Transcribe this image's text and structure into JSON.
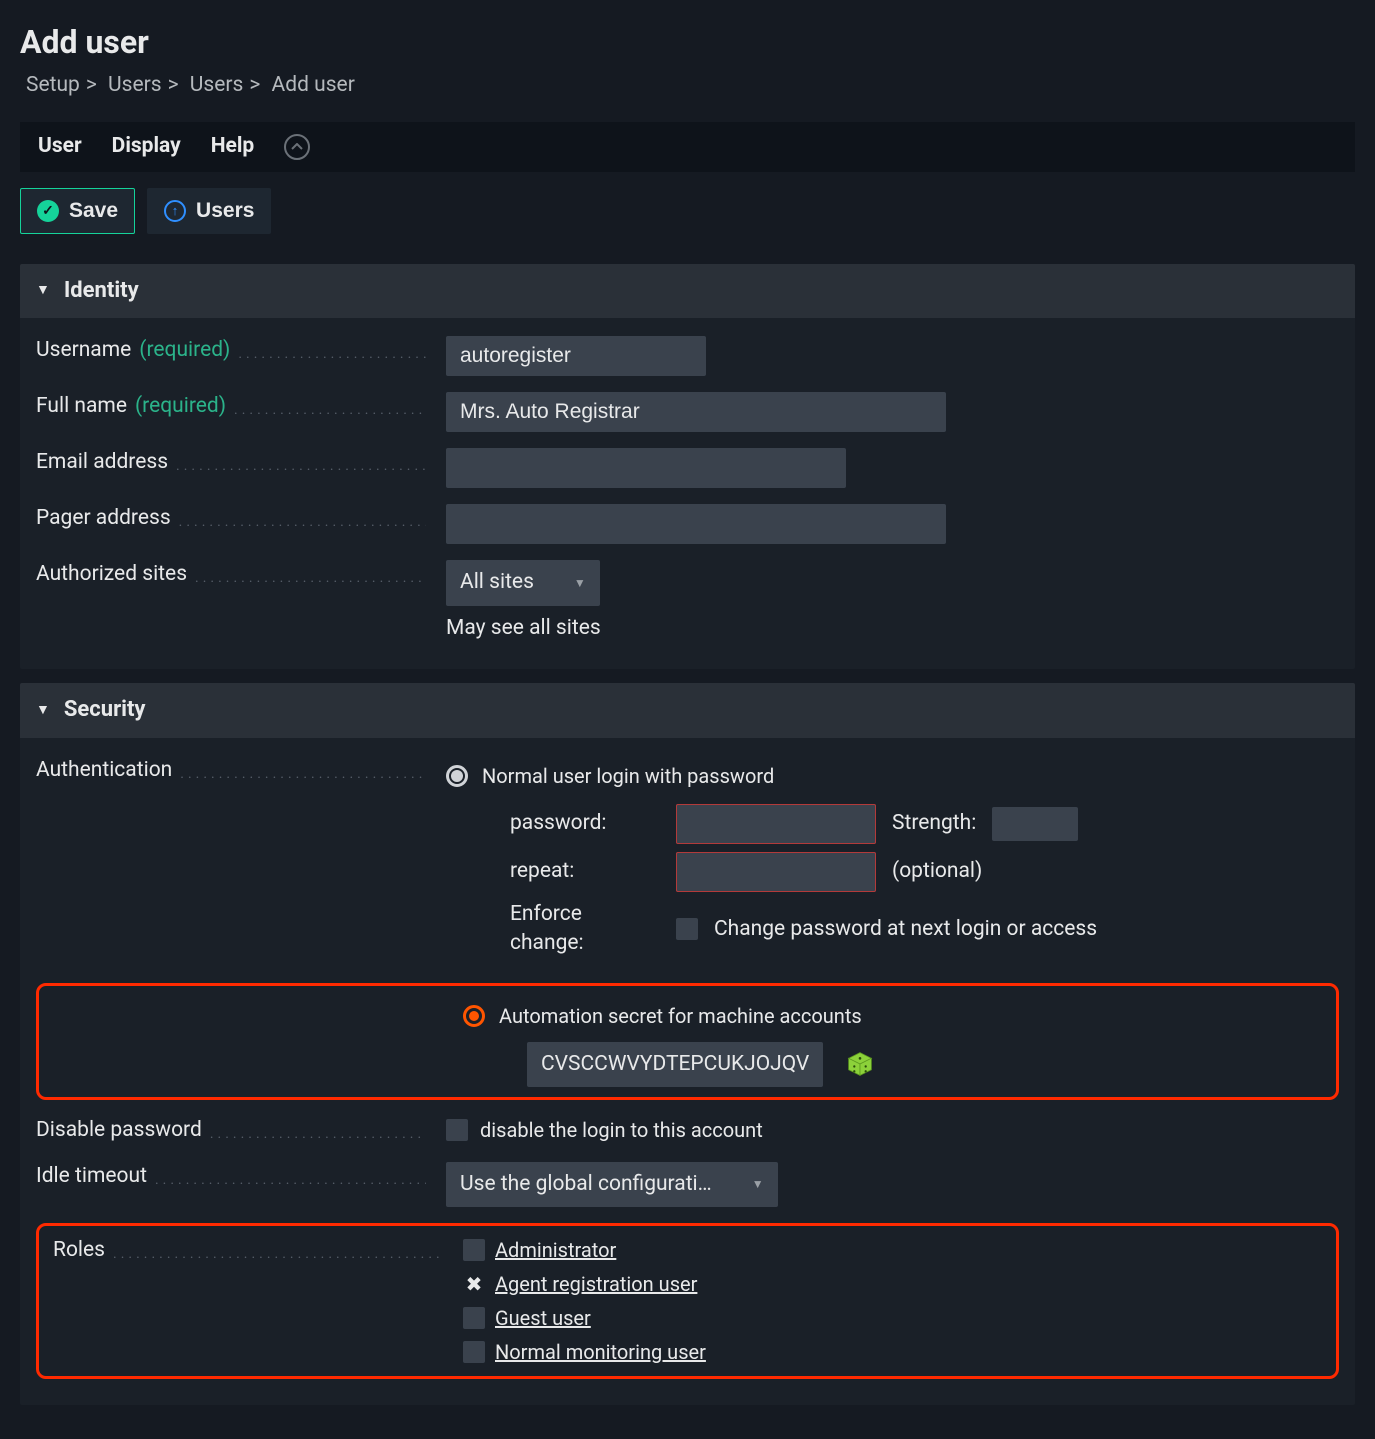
{
  "page": {
    "title": "Add user",
    "breadcrumbs": [
      "Setup",
      "Users",
      "Users",
      "Add user"
    ]
  },
  "menubar": {
    "items": [
      "User",
      "Display",
      "Help"
    ]
  },
  "actions": {
    "save": "Save",
    "users": "Users"
  },
  "sections": {
    "identity": {
      "title": "Identity",
      "username_label": "Username",
      "username_value": "autoregister",
      "fullname_label": "Full name",
      "fullname_value": "Mrs. Auto Registrar",
      "email_label": "Email address",
      "email_value": "",
      "pager_label": "Pager address",
      "pager_value": "",
      "sites_label": "Authorized sites",
      "sites_select": "All sites",
      "sites_hint": "May see all sites",
      "required": "(required)"
    },
    "security": {
      "title": "Security",
      "auth_label": "Authentication",
      "auth_opt_normal": "Normal user login with password",
      "auth_opt_secret": "Automation secret for machine accounts",
      "password_label": "password:",
      "repeat_label": "repeat:",
      "strength_label": "Strength:",
      "optional_hint": "(optional)",
      "enforce_label": "Enforce change:",
      "enforce_text": "Change password at next login or access",
      "secret_value": "CVSCCWVYDTEPCUKJOJQV",
      "disable_pw_label": "Disable password",
      "disable_pw_text": "disable the login to this account",
      "idle_label": "Idle timeout",
      "idle_select": "Use the global configurati…",
      "roles_label": "Roles",
      "roles": [
        {
          "name": "Administrator",
          "checked": false
        },
        {
          "name": "Agent registration user",
          "checked": true
        },
        {
          "name": "Guest user",
          "checked": false
        },
        {
          "name": "Normal monitoring user",
          "checked": false
        }
      ]
    }
  }
}
